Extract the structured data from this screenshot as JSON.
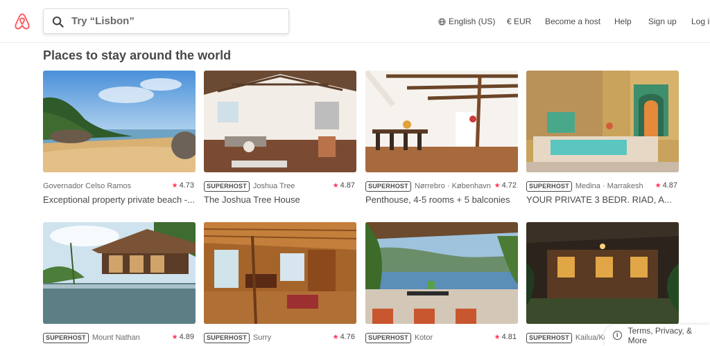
{
  "header": {
    "logo_icon": "airbnb-logo-icon",
    "search_placeholder": "Try “Lisbon”",
    "nav": {
      "language": "English (US)",
      "currency": "€ EUR",
      "become_host": "Become a host",
      "help": "Help",
      "sign_up": "Sign up",
      "log_in": "Log in"
    }
  },
  "section_title": "Places to stay around the world",
  "listings": [
    {
      "superhost": false,
      "badge": "",
      "location": "Governador Celso Ramos",
      "rating": "4.73",
      "title": "Exceptional property private beach -..."
    },
    {
      "superhost": true,
      "badge": "SUPERHOST",
      "location": "Joshua Tree",
      "rating": "4.87",
      "title": "The Joshua Tree House"
    },
    {
      "superhost": true,
      "badge": "SUPERHOST",
      "location": "Nørrebro · København",
      "rating": "4.72",
      "title": "Penthouse, 4-5 rooms + 5 balconies"
    },
    {
      "superhost": true,
      "badge": "SUPERHOST",
      "location": "Medina · Marrakesh",
      "rating": "4.87",
      "title": "YOUR PRIVATE 3 BEDR. RIAD, A..."
    },
    {
      "superhost": true,
      "badge": "SUPERHOST",
      "location": "Mount Nathan",
      "rating": "4.89",
      "title": ""
    },
    {
      "superhost": true,
      "badge": "SUPERHOST",
      "location": "Surry",
      "rating": "4.76",
      "title": ""
    },
    {
      "superhost": true,
      "badge": "SUPERHOST",
      "location": "Kotor",
      "rating": "4.81",
      "title": ""
    },
    {
      "superhost": true,
      "badge": "SUPERHOST",
      "location": "Kailua/Ko",
      "rating": "",
      "title": ""
    }
  ],
  "footer": {
    "label": "Terms, Privacy, & More",
    "icon": "info-icon"
  },
  "colors": {
    "brand": "#ff5a5f",
    "star": "#ff385c",
    "text": "#484848"
  }
}
